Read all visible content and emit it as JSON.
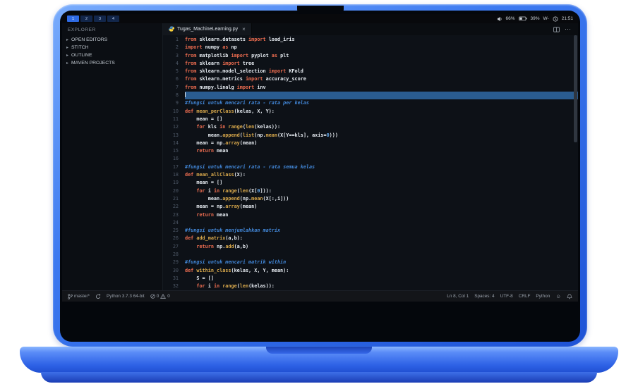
{
  "system_bar": {
    "workspaces": [
      "1",
      "2",
      "3",
      "4"
    ],
    "volume": "66%",
    "battery": "39%",
    "network": "W-",
    "time": "21:51"
  },
  "sidebar": {
    "title": "EXPLORER",
    "chevron": "▸",
    "items": [
      {
        "label": "OPEN EDITORS"
      },
      {
        "label": "STITCH"
      },
      {
        "label": "OUTLINE"
      },
      {
        "label": "MAVEN PROJECTS"
      }
    ]
  },
  "tab": {
    "title": "Tugas_MachineLearning.py",
    "close": "×"
  },
  "editor_actions": {
    "more": "⋯"
  },
  "editor": {
    "lines": [
      {
        "n": 1,
        "t": [
          [
            "kw",
            "from "
          ],
          [
            "pl",
            "sklearn.datasets "
          ],
          [
            "kw",
            "import "
          ],
          [
            "pl",
            "load_iris"
          ]
        ]
      },
      {
        "n": 2,
        "t": [
          [
            "kw",
            "import "
          ],
          [
            "pl",
            "numpy "
          ],
          [
            "kw",
            "as "
          ],
          [
            "pl",
            "np"
          ]
        ]
      },
      {
        "n": 3,
        "t": [
          [
            "kw",
            "from "
          ],
          [
            "pl",
            "matplotlib "
          ],
          [
            "kw",
            "import "
          ],
          [
            "pl",
            "pyplot "
          ],
          [
            "kw",
            "as "
          ],
          [
            "pl",
            "plt"
          ]
        ]
      },
      {
        "n": 4,
        "t": [
          [
            "kw",
            "from "
          ],
          [
            "pl",
            "sklearn "
          ],
          [
            "kw",
            "import "
          ],
          [
            "pl",
            "tree"
          ]
        ]
      },
      {
        "n": 5,
        "t": [
          [
            "kw",
            "from "
          ],
          [
            "pl",
            "sklearn.model_selection "
          ],
          [
            "kw",
            "import "
          ],
          [
            "pl",
            "KFold"
          ]
        ]
      },
      {
        "n": 6,
        "t": [
          [
            "kw",
            "from "
          ],
          [
            "pl",
            "sklearn.metrics "
          ],
          [
            "kw",
            "import "
          ],
          [
            "pl",
            "accuracy_score"
          ]
        ]
      },
      {
        "n": 7,
        "t": [
          [
            "kw",
            "from "
          ],
          [
            "pl",
            "numpy.linalg "
          ],
          [
            "kw",
            "import "
          ],
          [
            "pl",
            "inv"
          ]
        ]
      },
      {
        "n": 8,
        "t": [],
        "current": true,
        "caret": true
      },
      {
        "n": 9,
        "t": [
          [
            "cm",
            "#fungsi untuk mencari rata - rata per kelas"
          ]
        ]
      },
      {
        "n": 10,
        "t": [
          [
            "kw",
            "def "
          ],
          [
            "fn",
            "mean_perClass"
          ],
          [
            "pl",
            "(kelas, X, Y):"
          ]
        ]
      },
      {
        "n": 11,
        "t": [
          [
            "pl",
            "    mean = []"
          ]
        ]
      },
      {
        "n": 12,
        "t": [
          [
            "pl",
            "    "
          ],
          [
            "kw",
            "for "
          ],
          [
            "pl",
            "kls "
          ],
          [
            "kw",
            "in "
          ],
          [
            "fn",
            "range"
          ],
          [
            "pl",
            "("
          ],
          [
            "fn",
            "len"
          ],
          [
            "pl",
            "(kelas)):"
          ]
        ]
      },
      {
        "n": 13,
        "t": [
          [
            "pl",
            "        mean."
          ],
          [
            "fn",
            "append"
          ],
          [
            "pl",
            "("
          ],
          [
            "fn",
            "list"
          ],
          [
            "pl",
            "(np."
          ],
          [
            "fn",
            "mean"
          ],
          [
            "pl",
            "(X[Y==kls], axis="
          ],
          [
            "num",
            "0"
          ],
          [
            "pl",
            ")))"
          ]
        ]
      },
      {
        "n": 14,
        "t": [
          [
            "pl",
            "    mean = np."
          ],
          [
            "fn",
            "array"
          ],
          [
            "pl",
            "(mean)"
          ]
        ]
      },
      {
        "n": 15,
        "t": [
          [
            "pl",
            "    "
          ],
          [
            "kw",
            "return "
          ],
          [
            "pl",
            "mean"
          ]
        ]
      },
      {
        "n": 16,
        "t": []
      },
      {
        "n": 17,
        "t": [
          [
            "cm",
            "#fungsi untuk mencari rata - rata semua kelas"
          ]
        ]
      },
      {
        "n": 18,
        "t": [
          [
            "kw",
            "def "
          ],
          [
            "fn",
            "mean_allClass"
          ],
          [
            "pl",
            "(X):"
          ]
        ]
      },
      {
        "n": 19,
        "t": [
          [
            "pl",
            "    mean = []"
          ]
        ]
      },
      {
        "n": 20,
        "t": [
          [
            "pl",
            "    "
          ],
          [
            "kw",
            "for "
          ],
          [
            "pl",
            "i "
          ],
          [
            "kw",
            "in "
          ],
          [
            "fn",
            "range"
          ],
          [
            "pl",
            "("
          ],
          [
            "fn",
            "len"
          ],
          [
            "pl",
            "(X["
          ],
          [
            "num",
            "0"
          ],
          [
            "pl",
            "])):"
          ]
        ]
      },
      {
        "n": 21,
        "t": [
          [
            "pl",
            "        mean."
          ],
          [
            "fn",
            "append"
          ],
          [
            "pl",
            "(np."
          ],
          [
            "fn",
            "mean"
          ],
          [
            "pl",
            "(X[:,i]))"
          ]
        ]
      },
      {
        "n": 22,
        "t": [
          [
            "pl",
            "    mean = np."
          ],
          [
            "fn",
            "array"
          ],
          [
            "pl",
            "(mean)"
          ]
        ]
      },
      {
        "n": 23,
        "t": [
          [
            "pl",
            "    "
          ],
          [
            "kw",
            "return "
          ],
          [
            "pl",
            "mean"
          ]
        ]
      },
      {
        "n": 24,
        "t": []
      },
      {
        "n": 25,
        "t": [
          [
            "cm",
            "#fungsi untuk menjumlahkan matrix"
          ]
        ]
      },
      {
        "n": 26,
        "t": [
          [
            "kw",
            "def "
          ],
          [
            "fn",
            "add_matrix"
          ],
          [
            "pl",
            "(a,b):"
          ]
        ]
      },
      {
        "n": 27,
        "t": [
          [
            "pl",
            "    "
          ],
          [
            "kw",
            "return "
          ],
          [
            "pl",
            "np."
          ],
          [
            "fn",
            "add"
          ],
          [
            "pl",
            "(a,b)"
          ]
        ]
      },
      {
        "n": 28,
        "t": []
      },
      {
        "n": 29,
        "t": [
          [
            "cm",
            "#fungsi untuk mencari matrik within"
          ]
        ]
      },
      {
        "n": 30,
        "t": [
          [
            "kw",
            "def "
          ],
          [
            "fn",
            "within_class"
          ],
          [
            "pl",
            "(kelas, X, Y, mean):"
          ]
        ]
      },
      {
        "n": 31,
        "t": [
          [
            "pl",
            "    S = []"
          ]
        ]
      },
      {
        "n": 32,
        "t": [
          [
            "pl",
            "    "
          ],
          [
            "kw",
            "for "
          ],
          [
            "pl",
            "i "
          ],
          [
            "kw",
            "in "
          ],
          [
            "fn",
            "range"
          ],
          [
            "pl",
            "("
          ],
          [
            "fn",
            "len"
          ],
          [
            "pl",
            "(kelas)):"
          ]
        ]
      }
    ]
  },
  "status_bar": {
    "branch": "master*",
    "interpreter": "Python 3.7.3 64-bit",
    "errors": "0",
    "warnings": "0",
    "cursor": "Ln 8, Col 1",
    "indent": "Spaces: 4",
    "encoding": "UTF-8",
    "eol": "CRLF",
    "language": "Python",
    "feedback": "☺"
  },
  "colors": {
    "accent": "#2f6be4",
    "current_line": "#2a5c90",
    "keyword": "#ee6d50",
    "function": "#d9a94c",
    "comment": "#4287d8",
    "number": "#66aaec"
  }
}
